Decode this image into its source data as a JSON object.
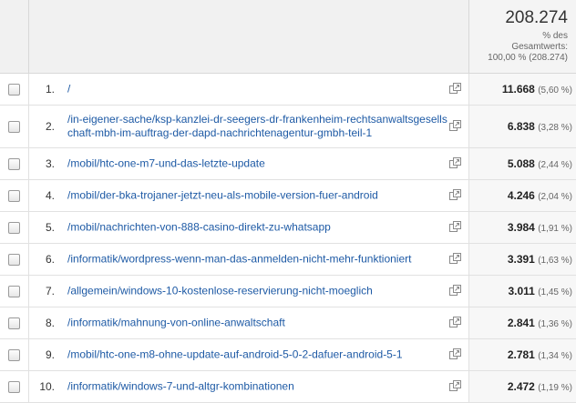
{
  "header": {
    "total": "208.274",
    "line1": "% des",
    "line2": "Gesamtwerts:",
    "line3": "100,00 % (208.274)"
  },
  "rows": [
    {
      "rank": "1.",
      "path": "/",
      "value": "11.668",
      "percent": "(5,60 %)"
    },
    {
      "rank": "2.",
      "path": "/in-eigener-sache/ksp-kanzlei-dr-seegers-dr-frankenheim-rechtsanwaltsgesellschaft-mbh-im-auftrag-der-dapd-nachrichtenagentur-gmbh-teil-1",
      "value": "6.838",
      "percent": "(3,28 %)"
    },
    {
      "rank": "3.",
      "path": "/mobil/htc-one-m7-und-das-letzte-update",
      "value": "5.088",
      "percent": "(2,44 %)"
    },
    {
      "rank": "4.",
      "path": "/mobil/der-bka-trojaner-jetzt-neu-als-mobile-version-fuer-android",
      "value": "4.246",
      "percent": "(2,04 %)"
    },
    {
      "rank": "5.",
      "path": "/mobil/nachrichten-von-888-casino-direkt-zu-whatsapp",
      "value": "3.984",
      "percent": "(1,91 %)"
    },
    {
      "rank": "6.",
      "path": "/informatik/wordpress-wenn-man-das-anmelden-nicht-mehr-funktioniert",
      "value": "3.391",
      "percent": "(1,63 %)"
    },
    {
      "rank": "7.",
      "path": "/allgemein/windows-10-kostenlose-reservierung-nicht-moeglich",
      "value": "3.011",
      "percent": "(1,45 %)"
    },
    {
      "rank": "8.",
      "path": "/informatik/mahnung-von-online-anwaltschaft",
      "value": "2.841",
      "percent": "(1,36 %)"
    },
    {
      "rank": "9.",
      "path": "/mobil/htc-one-m8-ohne-update-auf-android-5-0-2-dafuer-android-5-1",
      "value": "2.781",
      "percent": "(1,34 %)"
    },
    {
      "rank": "10.",
      "path": "/informatik/windows-7-und-altgr-kombinationen",
      "value": "2.472",
      "percent": "(1,19 %)"
    }
  ],
  "icons": {
    "checkbox": "checkbox",
    "external": "open-in-new-window-icon"
  }
}
